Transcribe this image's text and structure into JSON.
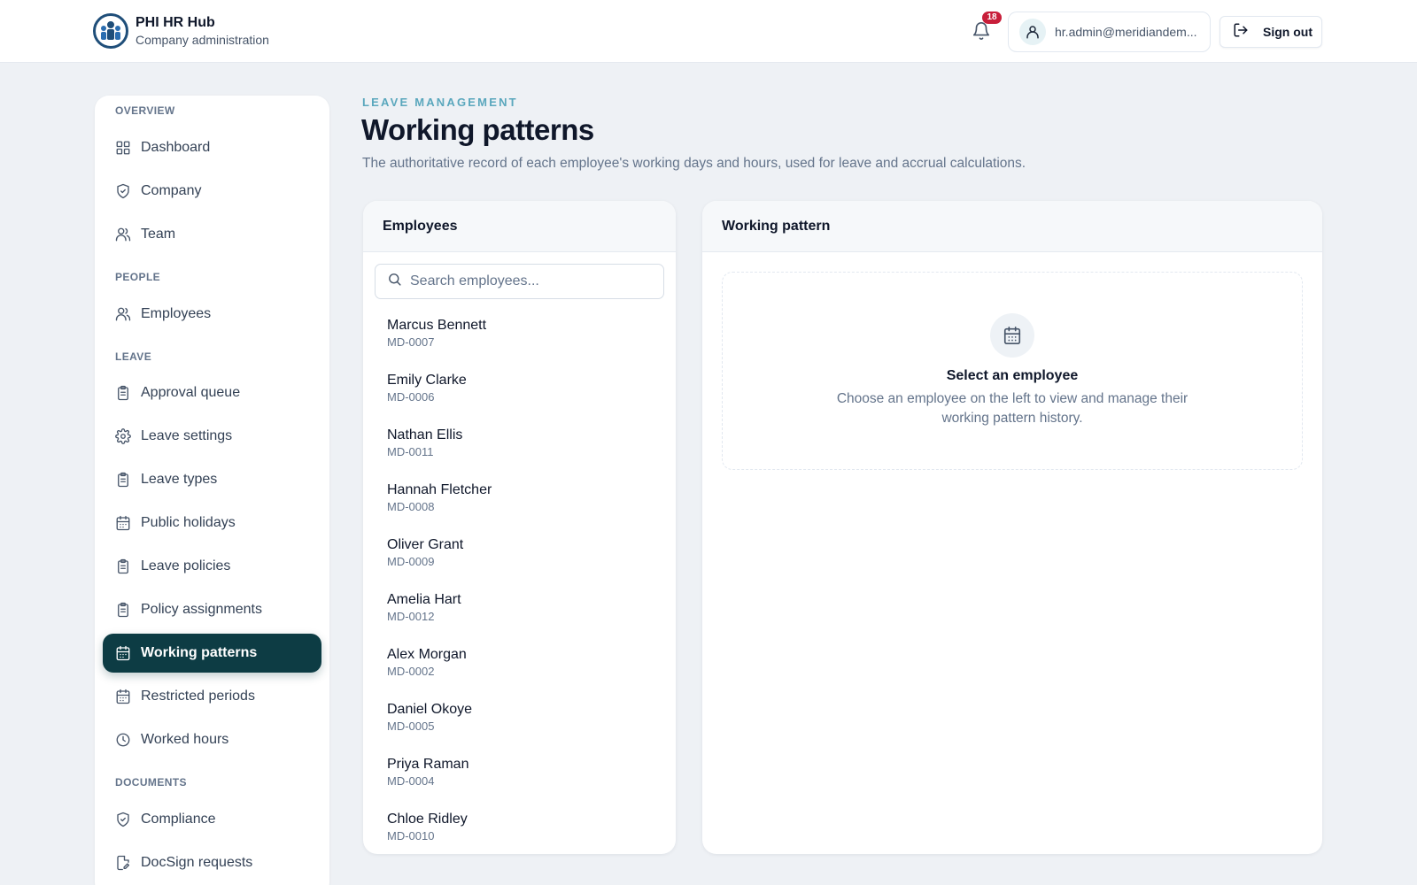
{
  "header": {
    "app_title": "PHI HR Hub",
    "app_subtitle": "Company administration",
    "notification_count": "18",
    "user_email": "hr.admin@meridiandem...",
    "sign_out_label": "Sign out"
  },
  "sidebar": {
    "sections": {
      "overview": "OVERVIEW",
      "people": "PEOPLE",
      "leave": "LEAVE",
      "documents": "DOCUMENTS"
    },
    "items": {
      "dashboard": "Dashboard",
      "company": "Company",
      "team": "Team",
      "employees": "Employees",
      "approval_queue": "Approval queue",
      "leave_settings": "Leave settings",
      "leave_types": "Leave types",
      "public_holidays": "Public holidays",
      "leave_policies": "Leave policies",
      "policy_assignments": "Policy assignments",
      "working_patterns": "Working patterns",
      "restricted_periods": "Restricted periods",
      "worked_hours": "Worked hours",
      "compliance": "Compliance",
      "docsign_requests": "DocSign requests"
    },
    "active_item": "Working patterns"
  },
  "page": {
    "eyebrow": "LEAVE MANAGEMENT",
    "title": "Working patterns",
    "description": "The authoritative record of each employee's working days and hours, used for leave and accrual calculations."
  },
  "employees_panel": {
    "title": "Employees",
    "search_placeholder": "Search employees...",
    "list": [
      {
        "name": "Marcus Bennett",
        "id": "MD-0007"
      },
      {
        "name": "Emily Clarke",
        "id": "MD-0006"
      },
      {
        "name": "Nathan Ellis",
        "id": "MD-0011"
      },
      {
        "name": "Hannah Fletcher",
        "id": "MD-0008"
      },
      {
        "name": "Oliver Grant",
        "id": "MD-0009"
      },
      {
        "name": "Amelia Hart",
        "id": "MD-0012"
      },
      {
        "name": "Alex Morgan",
        "id": "MD-0002"
      },
      {
        "name": "Daniel Okoye",
        "id": "MD-0005"
      },
      {
        "name": "Priya Raman",
        "id": "MD-0004"
      },
      {
        "name": "Chloe Ridley",
        "id": "MD-0010"
      }
    ]
  },
  "pattern_panel": {
    "title": "Working pattern",
    "empty_title": "Select an employee",
    "empty_description": "Choose an employee on the left to view and manage their working pattern history."
  },
  "colors": {
    "accent_dark": "#0d3c44",
    "eyebrow": "#5aa7bd",
    "badge": "#c81e3a",
    "background": "#eef1f5"
  }
}
